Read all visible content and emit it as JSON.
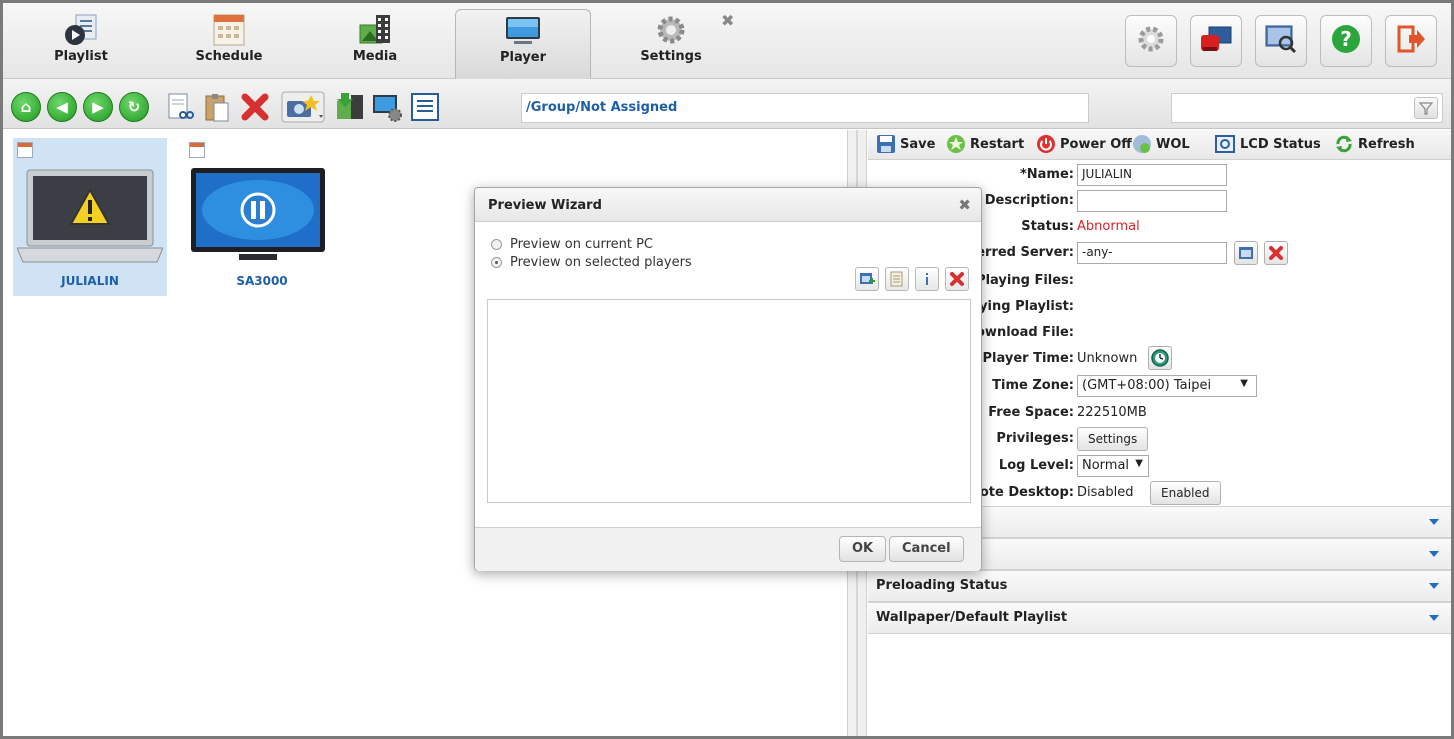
{
  "tabs": [
    {
      "label": "Playlist",
      "icon": "playlist-icon"
    },
    {
      "label": "Schedule",
      "icon": "calendar-icon"
    },
    {
      "label": "Media",
      "icon": "media-icon"
    },
    {
      "label": "Player",
      "icon": "monitor-icon",
      "active": true
    },
    {
      "label": "Settings",
      "icon": "gear-icon"
    }
  ],
  "top_buttons": [
    "gear-icon",
    "alarm-icon",
    "screen-search-icon",
    "help-icon",
    "logout-icon"
  ],
  "toolbar": {
    "path": "/Group/Not Assigned",
    "search_placeholder": ""
  },
  "players": [
    {
      "name": "JULIALIN",
      "state": "warning",
      "selected": true
    },
    {
      "name": "SA3000",
      "state": "paused",
      "selected": false
    }
  ],
  "detail_toolbar": {
    "save": "Save",
    "restart": "Restart",
    "power_off": "Power Off",
    "wol": "WOL",
    "lcd_status": "LCD Status",
    "refresh": "Refresh"
  },
  "details": {
    "name_label": "*Name:",
    "name_value": "JULIALIN",
    "description_label": "Description:",
    "description_value": "",
    "status_label": "Status:",
    "status_value": "Abnormal",
    "server_label": "erred Server:",
    "server_value": "-any-",
    "playing_files_label": "Playing Files:",
    "playing_playlist_label": "ying Playlist:",
    "download_file_label": "ownload File:",
    "player_time_label": "Player Time:",
    "player_time_value": "Unknown",
    "timezone_label": "Time Zone:",
    "timezone_value": "(GMT+08:00) Taipei",
    "free_space_label": "Free Space:",
    "free_space_value": "222510MB",
    "privileges_label": "Privileges:",
    "privileges_button": "Settings",
    "log_level_label": "Log Level:",
    "log_level_value": "Normal",
    "remote_label": "ote Desktop:",
    "remote_value": "Disabled",
    "remote_button": "Enabled"
  },
  "accordions": [
    "",
    "",
    "Preloading Status",
    "Wallpaper/Default Playlist"
  ],
  "dialog": {
    "title": "Preview Wizard",
    "option1": "Preview on current PC",
    "option2": "Preview on selected players",
    "ok": "OK",
    "cancel": "Cancel"
  },
  "colors": {
    "link_blue": "#1f5fa8",
    "status_red": "#d9242b",
    "selection": "#cfe3f4",
    "accent_green": "#1f9a21"
  }
}
